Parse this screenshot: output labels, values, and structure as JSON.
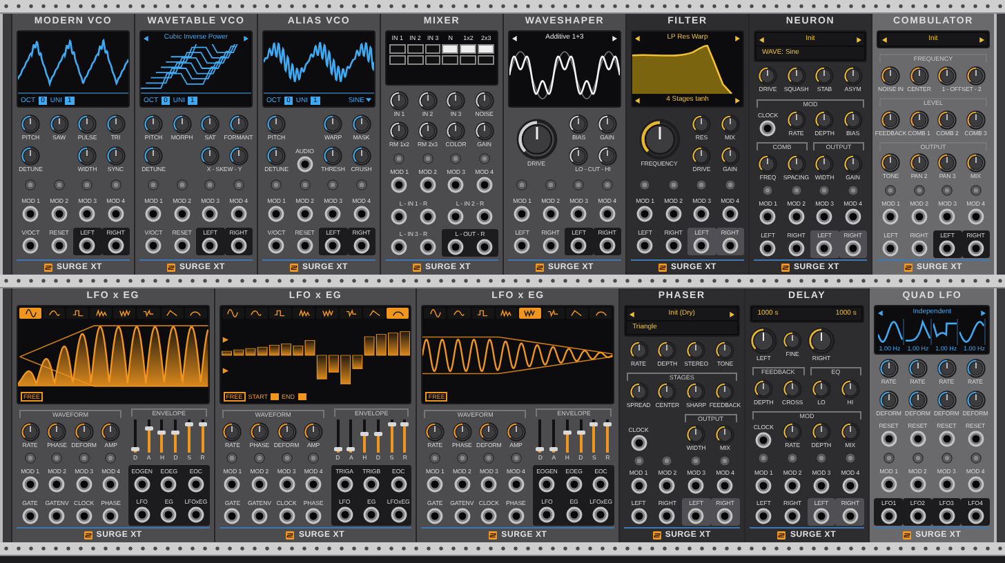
{
  "rows": [
    {
      "modules": [
        {
          "title": "MODERN VCO",
          "kind": "vco",
          "logo": "SURGE XT",
          "display": {
            "kind": "scope",
            "footer": [
              {
                "label": "OCT",
                "value": "0"
              },
              {
                "label": "UNI",
                "value": "1"
              }
            ]
          },
          "controls": [
            {
              "kind": "knob",
              "label": "PITCH"
            },
            {
              "kind": "knob",
              "label": "SAW"
            },
            {
              "kind": "knob",
              "label": "PULSE"
            },
            {
              "kind": "knob",
              "label": "TRI"
            },
            {
              "kind": "knob",
              "label": "DETUNE"
            },
            {
              "kind": "empty"
            },
            {
              "kind": "knob",
              "label": "WIDTH"
            },
            {
              "kind": "knob",
              "label": "SYNC"
            },
            {
              "kind": "dot"
            },
            {
              "kind": "dot"
            },
            {
              "kind": "dot"
            },
            {
              "kind": "dot"
            },
            {
              "kind": "jack",
              "label": "MOD 1",
              "boxed": false
            },
            {
              "kind": "jack",
              "label": "MOD 2",
              "boxed": false
            },
            {
              "kind": "jack",
              "label": "MOD 3",
              "boxed": false
            },
            {
              "kind": "jack",
              "label": "MOD 4",
              "boxed": false
            },
            {
              "kind": "jack",
              "label": "V/OCT",
              "boxed": false
            },
            {
              "kind": "jack",
              "label": "RESET",
              "boxed": false
            },
            {
              "kind": "jack",
              "label": "LEFT",
              "boxed": true
            },
            {
              "kind": "jack",
              "label": "RIGHT",
              "boxed": true
            }
          ]
        },
        {
          "title": "WAVETABLE VCO",
          "kind": "vco",
          "logo": "SURGE XT",
          "display": {
            "kind": "wavetable",
            "title": "Cubic Inverse Power",
            "footer": [
              {
                "label": "OCT",
                "value": "0"
              },
              {
                "label": "UNI",
                "value": "1"
              }
            ]
          },
          "controls": [
            {
              "kind": "knob",
              "label": "PITCH"
            },
            {
              "kind": "knob",
              "label": "MORPH"
            },
            {
              "kind": "knob",
              "label": "SAT"
            },
            {
              "kind": "knob",
              "label": "FORMANT"
            },
            {
              "kind": "knob",
              "label": "DETUNE"
            },
            {
              "kind": "empty"
            },
            {
              "kind": "knobpair",
              "label": "X - SKEW - Y"
            },
            {
              "kind": "dot"
            },
            {
              "kind": "dot"
            },
            {
              "kind": "dot"
            },
            {
              "kind": "dot"
            },
            {
              "kind": "jack",
              "label": "MOD 1",
              "boxed": false
            },
            {
              "kind": "jack",
              "label": "MOD 2",
              "boxed": false
            },
            {
              "kind": "jack",
              "label": "MOD 3",
              "boxed": false
            },
            {
              "kind": "jack",
              "label": "MOD 4",
              "boxed": false
            },
            {
              "kind": "jack",
              "label": "V/OCT",
              "boxed": false
            },
            {
              "kind": "jack",
              "label": "RESET",
              "boxed": false
            },
            {
              "kind": "jack",
              "label": "LEFT",
              "boxed": true
            },
            {
              "kind": "jack",
              "label": "RIGHT",
              "boxed": true
            }
          ]
        },
        {
          "title": "ALIAS VCO",
          "kind": "vco",
          "logo": "SURGE XT",
          "display": {
            "kind": "noisyscope",
            "footer": [
              {
                "label": "OCT",
                "value": "0"
              },
              {
                "label": "UNI",
                "value": "1"
              }
            ],
            "menu": "SINE"
          },
          "controls": [
            {
              "kind": "knob",
              "label": "PITCH"
            },
            {
              "kind": "empty"
            },
            {
              "kind": "knob",
              "label": "WARP"
            },
            {
              "kind": "knob",
              "label": "MASK"
            },
            {
              "kind": "knob",
              "label": "DETUNE"
            },
            {
              "kind": "jack",
              "label": "AUDIO",
              "boxed": false
            },
            {
              "kind": "knob",
              "label": "THRESH"
            },
            {
              "kind": "knob",
              "label": "CRUSH"
            },
            {
              "kind": "dot"
            },
            {
              "kind": "dot"
            },
            {
              "kind": "dot"
            },
            {
              "kind": "dot"
            },
            {
              "kind": "jack",
              "label": "MOD 1",
              "boxed": false
            },
            {
              "kind": "jack",
              "label": "MOD 2",
              "boxed": false
            },
            {
              "kind": "jack",
              "label": "MOD 3",
              "boxed": false
            },
            {
              "kind": "jack",
              "label": "MOD 4",
              "boxed": false
            },
            {
              "kind": "jack",
              "label": "V/OCT",
              "boxed": false
            },
            {
              "kind": "jack",
              "label": "RESET",
              "boxed": false
            },
            {
              "kind": "jack",
              "label": "LEFT",
              "boxed": true
            },
            {
              "kind": "jack",
              "label": "RIGHT",
              "boxed": true
            }
          ]
        },
        {
          "title": "MIXER",
          "kind": "utility",
          "logo": "SURGE XT",
          "display": {
            "kind": "matrix",
            "headers": [
              "IN 1",
              "IN 2",
              "IN 3",
              "N",
              "1x2",
              "2x3"
            ],
            "cells": [
              [
                false,
                false,
                false,
                true,
                true,
                true
              ],
              [
                false,
                false,
                false,
                false,
                false,
                false
              ]
            ]
          },
          "controls": [
            {
              "kind": "knob",
              "label": "IN 1"
            },
            {
              "kind": "knob",
              "label": "IN 2"
            },
            {
              "kind": "knob",
              "label": "IN 3"
            },
            {
              "kind": "knob",
              "label": "NOISE"
            },
            {
              "kind": "knob",
              "label": "RM 1x2"
            },
            {
              "kind": "knob",
              "label": "RM 2x3"
            },
            {
              "kind": "knob",
              "label": "COLOR"
            },
            {
              "kind": "knob",
              "label": "GAIN"
            },
            {
              "kind": "dot"
            },
            {
              "kind": "dot"
            },
            {
              "kind": "dot"
            },
            {
              "kind": "dot"
            },
            {
              "kind": "jack",
              "label": "MOD 1",
              "boxed": false
            },
            {
              "kind": "jack",
              "label": "MOD 2",
              "boxed": false
            },
            {
              "kind": "jack",
              "label": "MOD 3",
              "boxed": false
            },
            {
              "kind": "jack",
              "label": "MOD 4",
              "boxed": false
            },
            {
              "kind": "jackpair",
              "label": "L - IN 1 - R",
              "boxed": false
            },
            {
              "kind": "jackpair",
              "label": "L - IN 2 - R",
              "boxed": false
            },
            {
              "kind": "jackpair",
              "label": "L - IN 3 - R",
              "boxed": false
            },
            {
              "kind": "jackpair",
              "label": "L - OUT - R",
              "boxed": true
            }
          ]
        },
        {
          "title": "WAVESHAPER",
          "kind": "utility",
          "logo": "SURGE XT",
          "display": {
            "kind": "shaper",
            "title": "Additive 1+3"
          },
          "controls": [
            {
              "kind": "bigknob",
              "label": "DRIVE"
            },
            {
              "kind": "knob",
              "label": "BIAS"
            },
            {
              "kind": "knob",
              "label": "GAIN"
            },
            {
              "kind": "knobpair",
              "label": "LO - CUT - HI"
            },
            {
              "kind": "dot"
            },
            {
              "kind": "dot"
            },
            {
              "kind": "dot"
            },
            {
              "kind": "dot"
            },
            {
              "kind": "jack",
              "label": "MOD 1",
              "boxed": false
            },
            {
              "kind": "jack",
              "label": "MOD 2",
              "boxed": false
            },
            {
              "kind": "jack",
              "label": "MOD 3",
              "boxed": false
            },
            {
              "kind": "jack",
              "label": "MOD 4",
              "boxed": false
            },
            {
              "kind": "jack",
              "label": "LEFT",
              "boxed": false
            },
            {
              "kind": "jack",
              "label": "RIGHT",
              "boxed": false
            },
            {
              "kind": "jack",
              "label": "LEFT",
              "boxed": true
            },
            {
              "kind": "jack",
              "label": "RIGHT",
              "boxed": true
            }
          ]
        },
        {
          "title": "FILTER",
          "kind": "effect",
          "logo": "SURGE XT",
          "display": {
            "kind": "filter",
            "title": "LP Res Warp",
            "subtitle": "4 Stages tanh"
          },
          "controls": [
            {
              "kind": "bigknob",
              "label": "FREQUENCY"
            },
            {
              "kind": "knob",
              "label": "RES"
            },
            {
              "kind": "knob",
              "label": "MIX"
            },
            {
              "kind": "knob",
              "label": "DRIVE"
            },
            {
              "kind": "knob",
              "label": "GAIN"
            },
            {
              "kind": "dot"
            },
            {
              "kind": "dot"
            },
            {
              "kind": "dot"
            },
            {
              "kind": "dot"
            },
            {
              "kind": "jack",
              "label": "MOD 1",
              "boxed": false
            },
            {
              "kind": "jack",
              "label": "MOD 2",
              "boxed": false
            },
            {
              "kind": "jack",
              "label": "MOD 3",
              "boxed": false
            },
            {
              "kind": "jack",
              "label": "MOD 4",
              "boxed": false
            },
            {
              "kind": "jack",
              "label": "LEFT",
              "boxed": false
            },
            {
              "kind": "jack",
              "label": "RIGHT",
              "boxed": false
            },
            {
              "kind": "jack",
              "label": "LEFT",
              "boxed": true
            },
            {
              "kind": "jack",
              "label": "RIGHT",
              "boxed": true
            }
          ]
        },
        {
          "title": "NEURON",
          "kind": "effect",
          "logo": "SURGE XT",
          "display": {
            "kind": "menu",
            "lines": [
              {
                "texts": [
                  "Init"
                ],
                "arrows": true
              },
              {
                "texts": [
                  "WAVE: Sine"
                ],
                "arrows": false
              }
            ]
          },
          "controls": [
            {
              "kind": "knob",
              "label": "DRIVE"
            },
            {
              "kind": "knob",
              "label": "SQUASH"
            },
            {
              "kind": "knob",
              "label": "STAB"
            },
            {
              "kind": "knob",
              "label": "ASYM"
            },
            {
              "kind": "header",
              "label": "MOD"
            },
            {
              "kind": "jack",
              "label": "CLOCK",
              "boxed": false
            },
            {
              "kind": "knob",
              "label": "RATE"
            },
            {
              "kind": "knob",
              "label": "DEPTH"
            },
            {
              "kind": "knob",
              "label": "BIAS"
            },
            {
              "kind": "subheader",
              "label": "COMB"
            },
            {
              "kind": "subheader",
              "label": "OUTPUT"
            },
            {
              "kind": "knob",
              "label": "FREQ"
            },
            {
              "kind": "knob",
              "label": "SPACING"
            },
            {
              "kind": "knob",
              "label": "WIDTH"
            },
            {
              "kind": "knob",
              "label": "GAIN"
            },
            {
              "kind": "dot"
            },
            {
              "kind": "dot"
            },
            {
              "kind": "dot"
            },
            {
              "kind": "dot"
            },
            {
              "kind": "jack",
              "label": "MOD 1",
              "boxed": false
            },
            {
              "kind": "jack",
              "label": "MOD 2",
              "boxed": false
            },
            {
              "kind": "jack",
              "label": "MOD 3",
              "boxed": false
            },
            {
              "kind": "jack",
              "label": "MOD 4",
              "boxed": false
            },
            {
              "kind": "jack",
              "label": "LEFT",
              "boxed": false
            },
            {
              "kind": "jack",
              "label": "RIGHT",
              "boxed": false
            },
            {
              "kind": "jack",
              "label": "LEFT",
              "boxed": true
            },
            {
              "kind": "jack",
              "label": "RIGHT",
              "boxed": true
            }
          ]
        },
        {
          "title": "COMBULATOR",
          "kind": "resonator",
          "logo": "SURGE XT",
          "display": {
            "kind": "menu",
            "lines": [
              {
                "texts": [
                  "Init"
                ],
                "arrows": true
              }
            ]
          },
          "controls": [
            {
              "kind": "header",
              "label": "FREQUENCY"
            },
            {
              "kind": "knob",
              "label": "NOISE IN"
            },
            {
              "kind": "knob",
              "label": "CENTER"
            },
            {
              "kind": "knobpair",
              "label": "1 - OFFSET - 2"
            },
            {
              "kind": "header",
              "label": "LEVEL"
            },
            {
              "kind": "knob",
              "label": "FEEDBACK"
            },
            {
              "kind": "knob",
              "label": "COMB 1"
            },
            {
              "kind": "knob",
              "label": "COMB 2"
            },
            {
              "kind": "knob",
              "label": "COMB 3"
            },
            {
              "kind": "header",
              "label": "OUTPUT"
            },
            {
              "kind": "knob",
              "label": "TONE"
            },
            {
              "kind": "knob",
              "label": "PAN 2"
            },
            {
              "kind": "knob",
              "label": "PAN 3"
            },
            {
              "kind": "knob",
              "label": "MIX"
            },
            {
              "kind": "dot"
            },
            {
              "kind": "dot"
            },
            {
              "kind": "dot"
            },
            {
              "kind": "dot"
            },
            {
              "kind": "jack",
              "label": "MOD 1",
              "boxed": false
            },
            {
              "kind": "jack",
              "label": "MOD 2",
              "boxed": false
            },
            {
              "kind": "jack",
              "label": "MOD 3",
              "boxed": false
            },
            {
              "kind": "jack",
              "label": "MOD 4",
              "boxed": false
            },
            {
              "kind": "jack",
              "label": "LEFT",
              "boxed": false
            },
            {
              "kind": "jack",
              "label": "RIGHT",
              "boxed": false
            },
            {
              "kind": "jack",
              "label": "LEFT",
              "boxed": true
            },
            {
              "kind": "jack",
              "label": "RIGHT",
              "boxed": true
            }
          ]
        }
      ]
    },
    {
      "modules": [
        {
          "title": "LFO x EG",
          "kind": "lfo",
          "logo": "SURGE XT",
          "display": {
            "kind": "envlfo",
            "shapes": [
              {
                "selected": true
              },
              {
                "selected": false
              },
              {
                "selected": false
              },
              {
                "selected": false
              },
              {
                "selected": false
              },
              {
                "selected": false
              },
              {
                "selected": false
              },
              {
                "selected": false
              }
            ],
            "footer": [
              {
                "kind": "tag",
                "label": "FREE"
              }
            ]
          },
          "controls": [
            {
              "kind": "header",
              "label": "WAVEFORM"
            },
            {
              "kind": "knob",
              "label": "RATE"
            },
            {
              "kind": "knob",
              "label": "PHASE"
            },
            {
              "kind": "knob",
              "label": "DEFORM"
            },
            {
              "kind": "knob",
              "label": "AMP"
            },
            {
              "kind": "dot"
            },
            {
              "kind": "dot"
            },
            {
              "kind": "dot"
            },
            {
              "kind": "dot"
            },
            {
              "kind": "jack",
              "label": "MOD 1",
              "boxed": false
            },
            {
              "kind": "jack",
              "label": "MOD 2",
              "boxed": false
            },
            {
              "kind": "jack",
              "label": "MOD 3",
              "boxed": false
            },
            {
              "kind": "jack",
              "label": "MOD 4",
              "boxed": false
            },
            {
              "kind": "jack",
              "label": "GATE",
              "boxed": false
            },
            {
              "kind": "jack",
              "label": "GATENV",
              "boxed": false
            },
            {
              "kind": "jack",
              "label": "CLOCK",
              "boxed": false
            },
            {
              "kind": "jack",
              "label": "PHASE",
              "boxed": false
            }
          ],
          "envelope": {
            "title": "ENVELOPE",
            "sliders": [
              {
                "label": "D",
                "level": 0.1
              },
              {
                "label": "A",
                "level": 0.75
              },
              {
                "label": "H",
                "level": 0.6
              },
              {
                "label": "D",
                "level": 0.6
              },
              {
                "label": "S",
                "level": 0.85
              },
              {
                "label": "R",
                "level": 0.85
              }
            ],
            "jacks": [
              "EOGEN",
              "EOEG",
              "EOC",
              "LFO",
              "EG",
              "LFOxEG"
            ]
          }
        },
        {
          "title": "LFO x EG",
          "kind": "lfo",
          "logo": "SURGE XT",
          "display": {
            "kind": "steplfo",
            "shapes": [
              {
                "selected": false
              },
              {
                "selected": false
              },
              {
                "selected": false
              },
              {
                "selected": false
              },
              {
                "selected": false
              },
              {
                "selected": false
              },
              {
                "selected": false
              },
              {
                "selected": true
              }
            ],
            "footer": [
              {
                "kind": "tag",
                "label": "FREE"
              },
              {
                "kind": "field",
                "label": "START"
              },
              {
                "kind": "field",
                "label": "END"
              }
            ]
          },
          "controls": [
            {
              "kind": "header",
              "label": "WAVEFORM"
            },
            {
              "kind": "knob",
              "label": "RATE"
            },
            {
              "kind": "knob",
              "label": "PHASE"
            },
            {
              "kind": "knob",
              "label": "DEFORM"
            },
            {
              "kind": "knob",
              "label": "AMP"
            },
            {
              "kind": "dot"
            },
            {
              "kind": "dot"
            },
            {
              "kind": "dot"
            },
            {
              "kind": "dot"
            },
            {
              "kind": "jack",
              "label": "MOD 1",
              "boxed": false
            },
            {
              "kind": "jack",
              "label": "MOD 2",
              "boxed": false
            },
            {
              "kind": "jack",
              "label": "MOD 3",
              "boxed": false
            },
            {
              "kind": "jack",
              "label": "MOD 4",
              "boxed": false
            },
            {
              "kind": "jack",
              "label": "GATE",
              "boxed": false
            },
            {
              "kind": "jack",
              "label": "GATENV",
              "boxed": false
            },
            {
              "kind": "jack",
              "label": "CLOCK",
              "boxed": false
            },
            {
              "kind": "jack",
              "label": "PHASE",
              "boxed": false
            }
          ],
          "envelope": {
            "title": "ENVELOPE",
            "sliders": [
              {
                "label": "D",
                "level": 0.1
              },
              {
                "label": "A",
                "level": 0.1
              },
              {
                "label": "H",
                "level": 0.55
              },
              {
                "label": "D",
                "level": 0.55
              },
              {
                "label": "S",
                "level": 0.85
              },
              {
                "label": "R",
                "level": 0.85
              }
            ],
            "jacks": [
              "TRIGA",
              "TRIGB",
              "EOC",
              "LFO",
              "EG",
              "LFOxEG"
            ]
          }
        },
        {
          "title": "LFO x EG",
          "kind": "lfo",
          "logo": "SURGE XT",
          "display": {
            "kind": "decaylfo",
            "shapes": [
              {
                "selected": false
              },
              {
                "selected": false
              },
              {
                "selected": false
              },
              {
                "selected": false
              },
              {
                "selected": true
              },
              {
                "selected": false
              },
              {
                "selected": false
              },
              {
                "selected": false
              }
            ],
            "footer": [
              {
                "kind": "tag",
                "label": "FREE"
              }
            ]
          },
          "controls": [
            {
              "kind": "header",
              "label": "WAVEFORM"
            },
            {
              "kind": "knob",
              "label": "RATE"
            },
            {
              "kind": "knob",
              "label": "PHASE"
            },
            {
              "kind": "knob",
              "label": "DEFORM"
            },
            {
              "kind": "knob",
              "label": "AMP"
            },
            {
              "kind": "dot"
            },
            {
              "kind": "dot"
            },
            {
              "kind": "dot"
            },
            {
              "kind": "dot"
            },
            {
              "kind": "jack",
              "label": "MOD 1",
              "boxed": false
            },
            {
              "kind": "jack",
              "label": "MOD 2",
              "boxed": false
            },
            {
              "kind": "jack",
              "label": "MOD 3",
              "boxed": false
            },
            {
              "kind": "jack",
              "label": "MOD 4",
              "boxed": false
            },
            {
              "kind": "jack",
              "label": "GATE",
              "boxed": false
            },
            {
              "kind": "jack",
              "label": "GATENV",
              "boxed": false
            },
            {
              "kind": "jack",
              "label": "CLOCK",
              "boxed": false
            },
            {
              "kind": "jack",
              "label": "PHASE",
              "boxed": false
            }
          ],
          "envelope": {
            "title": "ENVELOPE",
            "sliders": [
              {
                "label": "D",
                "level": 0.1
              },
              {
                "label": "A",
                "level": 0.1
              },
              {
                "label": "H",
                "level": 0.6
              },
              {
                "label": "D",
                "level": 0.6
              },
              {
                "label": "S",
                "level": 0.85
              },
              {
                "label": "R",
                "level": 0.85
              }
            ],
            "jacks": [
              "EOGEN",
              "EOEG",
              "EOC",
              "LFO",
              "EG",
              "LFOxEG"
            ]
          }
        },
        {
          "title": "PHASER",
          "kind": "effect",
          "logo": "SURGE XT",
          "display": {
            "kind": "menu",
            "lines": [
              {
                "texts": [
                  "Init (Dry)"
                ],
                "arrows": true
              },
              {
                "texts": [
                  "Triangle"
                ],
                "arrows": false
              }
            ]
          },
          "controls": [
            {
              "kind": "knob",
              "label": "RATE"
            },
            {
              "kind": "knob",
              "label": "DEPTH"
            },
            {
              "kind": "knob",
              "label": "STEREO"
            },
            {
              "kind": "knob",
              "label": "TONE"
            },
            {
              "kind": "header",
              "label": "STAGES"
            },
            {
              "kind": "knob",
              "label": "SPREAD"
            },
            {
              "kind": "knob",
              "label": "CENTER"
            },
            {
              "kind": "knob",
              "label": "SHARP"
            },
            {
              "kind": "knob",
              "label": "FEEDBACK"
            },
            {
              "kind": "empty"
            },
            {
              "kind": "empty"
            },
            {
              "kind": "subheader",
              "label": "OUTPUT"
            },
            {
              "kind": "jack",
              "label": "CLOCK",
              "boxed": false
            },
            {
              "kind": "empty"
            },
            {
              "kind": "knob",
              "label": "WIDTH"
            },
            {
              "kind": "knob",
              "label": "MIX"
            },
            {
              "kind": "dot"
            },
            {
              "kind": "dot"
            },
            {
              "kind": "dot"
            },
            {
              "kind": "dot"
            },
            {
              "kind": "jack",
              "label": "MOD 1",
              "boxed": false
            },
            {
              "kind": "jack",
              "label": "MOD 2",
              "boxed": false
            },
            {
              "kind": "jack",
              "label": "MOD 3",
              "boxed": false
            },
            {
              "kind": "jack",
              "label": "MOD 4",
              "boxed": false
            },
            {
              "kind": "jack",
              "label": "LEFT",
              "boxed": false
            },
            {
              "kind": "jack",
              "label": "RIGHT",
              "boxed": false
            },
            {
              "kind": "jack",
              "label": "LEFT",
              "boxed": true
            },
            {
              "kind": "jack",
              "label": "RIGHT",
              "boxed": true
            }
          ]
        },
        {
          "title": "DELAY",
          "kind": "effect",
          "logo": "SURGE XT",
          "display": {
            "kind": "menu",
            "lines": [
              {
                "texts": [
                  "1000 s",
                  "1000 s"
                ],
                "arrows": false
              }
            ]
          },
          "controls": [
            {
              "kind": "largeknob",
              "label": "LEFT"
            },
            {
              "kind": "knob",
              "label": "FINE"
            },
            {
              "kind": "largeknob",
              "label": "RIGHT"
            },
            {
              "kind": "empty"
            },
            {
              "kind": "subheader",
              "label": "FEEDBACK"
            },
            {
              "kind": "subheader",
              "label": "EQ"
            },
            {
              "kind": "knob",
              "label": "DEPTH"
            },
            {
              "kind": "knob",
              "label": "CROSS"
            },
            {
              "kind": "knob",
              "label": "LO"
            },
            {
              "kind": "knob",
              "label": "HI"
            },
            {
              "kind": "header",
              "label": "MOD"
            },
            {
              "kind": "jack",
              "label": "CLOCK",
              "boxed": false
            },
            {
              "kind": "knob",
              "label": "RATE"
            },
            {
              "kind": "knob",
              "label": "DEPTH"
            },
            {
              "kind": "knob",
              "label": "MIX"
            },
            {
              "kind": "dot"
            },
            {
              "kind": "dot"
            },
            {
              "kind": "dot"
            },
            {
              "kind": "dot"
            },
            {
              "kind": "jack",
              "label": "MOD 1",
              "boxed": false
            },
            {
              "kind": "jack",
              "label": "MOD 2",
              "boxed": false
            },
            {
              "kind": "jack",
              "label": "MOD 3",
              "boxed": false
            },
            {
              "kind": "jack",
              "label": "MOD 4",
              "boxed": false
            },
            {
              "kind": "jack",
              "label": "LEFT",
              "boxed": false
            },
            {
              "kind": "jack",
              "label": "RIGHT",
              "boxed": false
            },
            {
              "kind": "jack",
              "label": "LEFT",
              "boxed": true
            },
            {
              "kind": "jack",
              "label": "RIGHT",
              "boxed": true
            }
          ]
        },
        {
          "title": "QUAD LFO",
          "kind": "quad",
          "logo": "SURGE XT",
          "display": {
            "kind": "quad",
            "title": "Independent",
            "readings": [
              "1.00 Hz",
              "1.00 Hz",
              "1.00 Hz",
              "1.00 Hz"
            ]
          },
          "controls": [
            {
              "kind": "knob",
              "label": "RATE"
            },
            {
              "kind": "knob",
              "label": "RATE"
            },
            {
              "kind": "knob",
              "label": "RATE"
            },
            {
              "kind": "knob",
              "label": "RATE"
            },
            {
              "kind": "knob",
              "label": "DEFORM"
            },
            {
              "kind": "knob",
              "label": "DEFORM"
            },
            {
              "kind": "knob",
              "label": "DEFORM"
            },
            {
              "kind": "knob",
              "label": "DEFORM"
            },
            {
              "kind": "jack",
              "label": "RESET",
              "boxed": false
            },
            {
              "kind": "jack",
              "label": "RESET",
              "boxed": false
            },
            {
              "kind": "jack",
              "label": "RESET",
              "boxed": false
            },
            {
              "kind": "jack",
              "label": "RESET",
              "boxed": false
            },
            {
              "kind": "dot"
            },
            {
              "kind": "dot"
            },
            {
              "kind": "dot"
            },
            {
              "kind": "dot"
            },
            {
              "kind": "jack",
              "label": "MOD 1",
              "boxed": false
            },
            {
              "kind": "jack",
              "label": "MOD 2",
              "boxed": false
            },
            {
              "kind": "jack",
              "label": "MOD 3",
              "boxed": false
            },
            {
              "kind": "jack",
              "label": "MOD 4",
              "boxed": false
            },
            {
              "kind": "jack",
              "label": "LFO1",
              "boxed": true
            },
            {
              "kind": "jack",
              "label": "LFO2",
              "boxed": true
            },
            {
              "kind": "jack",
              "label": "LFO3",
              "boxed": true
            },
            {
              "kind": "jack",
              "label": "LFO4",
              "boxed": true
            }
          ]
        }
      ]
    }
  ]
}
